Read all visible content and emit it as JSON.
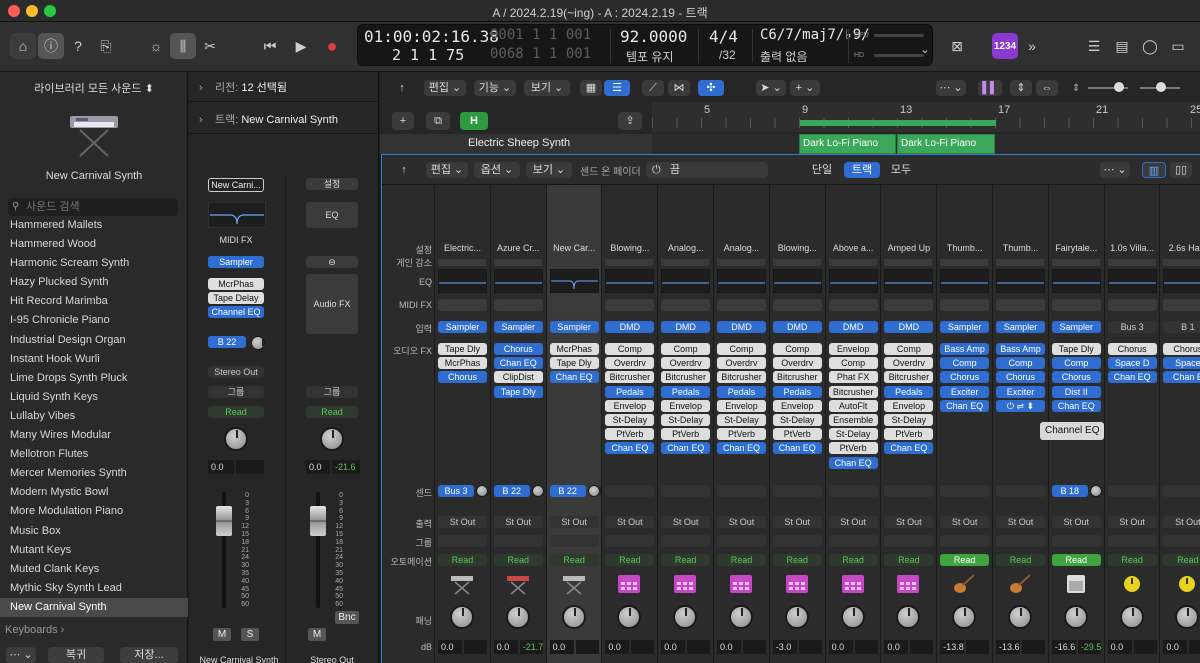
{
  "window": {
    "title": "A / 2024.2.19(~ing) - A : 2024.2.19 - 트랙"
  },
  "lcd": {
    "time": "01:00:02:16.38",
    "time_ghost": "0001 1 1 001",
    "bars": "2  1  1   75",
    "bars_ghost": "0068 1 1 001",
    "tempo": "92.0000",
    "tempo_label": "템포 유지",
    "sig_top": "4/4",
    "sig_bottom": "/32",
    "chord": "C6/7/maj7/♭9/",
    "output": "출력 없음",
    "cpu": "CPU",
    "hd": "HD"
  },
  "count_in": "1234",
  "library": {
    "header": "라이브러리   모든 사운드 ⬍",
    "patch": "New Carnival Synth",
    "search_placeholder": "사운드 검색",
    "items": [
      "Hammered Mallets",
      "Hammered Wood",
      "Harmonic Scream Synth",
      "Hazy Plucked Synth",
      "Hit Record Marimba",
      "I-95 Chronicle Piano",
      "Industrial Design Organ",
      "Instant Hook Wurli",
      "Lime Drops Synth Pluck",
      "Liquid Synth Keys",
      "Lullaby Vibes",
      "Many Wires Modular",
      "Mellotron Flutes",
      "Mercer Memories Synth",
      "Modern Mystic Bowl",
      "More Modulation Piano",
      "Music Box",
      "Mutant Keys",
      "Muted Clank Keys",
      "Mythic Sky Synth Lead",
      "New Carnival Synth"
    ],
    "selected_index": 20,
    "keyboards": "Keyboards ›",
    "revert": "복귀",
    "save": "저장..."
  },
  "inspector": {
    "region_key": "리전:",
    "region_val": "12 선택됨",
    "track_key": "트랙:",
    "track_val": "New Carnival Synth",
    "strip1": {
      "setting": "New Carni...",
      "midifx": "MIDI FX",
      "instrument": "Sampler",
      "fx": [
        "McrPhas",
        "Tape Delay",
        "Channel EQ"
      ],
      "send": "B 22",
      "output": "Stereo Out",
      "group": "그룹",
      "auto": "Read",
      "vol": "0.0",
      "peak": "",
      "m": "M",
      "s": "S",
      "name": "New Carnival Synth"
    },
    "strip2": {
      "setting": "설정",
      "eq": "EQ",
      "audiofx": "Audio FX",
      "group": "그룹",
      "auto": "Read",
      "vol": "0.0",
      "peak": "-21.6",
      "m": "M",
      "bnc": "Bnc",
      "name": "Stereo Out"
    },
    "scale": [
      "0",
      "3",
      "6",
      "9",
      "12",
      "15",
      "18",
      "21",
      "24",
      "30",
      "35",
      "40",
      "45",
      "50",
      "60"
    ]
  },
  "tracks": {
    "edit": "편집",
    "func": "기능",
    "view": "보기",
    "h_btn": "H",
    "ruler": [
      "5",
      "9",
      "13",
      "17",
      "21",
      "25"
    ],
    "track_name": "Electric Sheep Synth",
    "regions": [
      "Dark Lo-Fi Piano",
      "Dark Lo-Fi Piano"
    ]
  },
  "mixer": {
    "edit": "편집",
    "options": "옵션",
    "view": "보기",
    "sends_on_faders": "센드 온 페이더",
    "off": "끔",
    "single": "단일",
    "tracks": "트랙",
    "all": "모두",
    "row_labels": {
      "setting": "설정",
      "gain": "게인 감소",
      "eq": "EQ",
      "midifx": "MIDI FX",
      "input": "입력",
      "audiofx": "오디오 FX",
      "send": "센드",
      "output": "출력",
      "group": "그룹",
      "automation": "오토메이션",
      "pan": "패닝",
      "db": "dB"
    },
    "tooltip": "Channel EQ",
    "strips": [
      {
        "name": "Electric...",
        "input": "Sampler",
        "fx": [
          "Tape Dly",
          "McrPhas",
          "Chorus"
        ],
        "send": "Bus 3",
        "out": "St Out",
        "auto": "Read",
        "db": "0.0",
        "peak": "",
        "icon": "keyboard-stand-icon"
      },
      {
        "name": "Azure Cr...",
        "input": "Sampler",
        "fx": [
          "Chorus",
          "Chan EQ",
          "ClipDist",
          "Tape Dly"
        ],
        "send": "B 22",
        "out": "St Out",
        "auto": "Read",
        "db": "0.0",
        "peak": "-21.7",
        "icon": "keyboard-stand-red-icon"
      },
      {
        "name": "New Car...",
        "input": "Sampler",
        "fx": [
          "McrPhas",
          "Tape Dly",
          "Chan EQ"
        ],
        "send": "B 22",
        "out": "St Out",
        "auto": "Read",
        "db": "0.0",
        "peak": "",
        "icon": "keyboard-stand-icon"
      },
      {
        "name": "Blowing...",
        "input": "DMD",
        "fx": [
          "Comp",
          "Overdrv",
          "Bitcrusher",
          "Pedals",
          "Envelop",
          "St-Delay",
          "PtVerb",
          "Chan EQ"
        ],
        "send": "",
        "out": "St Out",
        "auto": "Read",
        "db": "0.0",
        "peak": "",
        "icon": "drum-machine-icon"
      },
      {
        "name": "Analog...",
        "input": "DMD",
        "fx": [
          "Comp",
          "Overdrv",
          "Bitcrusher",
          "Pedals",
          "Envelop",
          "St-Delay",
          "PtVerb",
          "Chan EQ"
        ],
        "send": "",
        "out": "St Out",
        "auto": "Read",
        "db": "0.0",
        "peak": "",
        "icon": "drum-machine-icon"
      },
      {
        "name": "Analog...",
        "input": "DMD",
        "fx": [
          "Comp",
          "Overdrv",
          "Bitcrusher",
          "Pedals",
          "Envelop",
          "St-Delay",
          "PtVerb",
          "Chan EQ"
        ],
        "send": "",
        "out": "St Out",
        "auto": "Read",
        "db": "0.0",
        "peak": "",
        "icon": "drum-machine-icon"
      },
      {
        "name": "Blowing...",
        "input": "DMD",
        "fx": [
          "Comp",
          "Overdrv",
          "Bitcrusher",
          "Pedals",
          "Envelop",
          "St-Delay",
          "PtVerb",
          "Chan EQ"
        ],
        "send": "",
        "out": "St Out",
        "auto": "Read",
        "db": "-3.0",
        "peak": "",
        "icon": "drum-machine-icon"
      },
      {
        "name": "Above a...",
        "input": "DMD",
        "fx": [
          "Envelop",
          "Comp",
          "Phat FX",
          "Bitcrusher",
          "AutoFlt",
          "Ensemble",
          "St-Delay",
          "PtVerb",
          "Chan EQ"
        ],
        "send": "",
        "out": "St Out",
        "auto": "Read",
        "db": "0.0",
        "peak": "",
        "icon": "drum-machine-icon"
      },
      {
        "name": "Amped Up",
        "input": "DMD",
        "fx": [
          "Comp",
          "Overdrv",
          "Bitcrusher",
          "Pedals",
          "Envelop",
          "St-Delay",
          "PtVerb",
          "Chan EQ"
        ],
        "send": "",
        "out": "St Out",
        "auto": "Read",
        "db": "0.0",
        "peak": "",
        "icon": "drum-machine-icon"
      },
      {
        "name": "Thumb...",
        "input": "Sampler",
        "fx": [
          "Bass Amp",
          "Comp",
          "Chorus",
          "Exciter",
          "Chan EQ"
        ],
        "send": "",
        "out": "St Out",
        "auto": "Read",
        "db": "-13.8",
        "peak": "",
        "icon": "guitar-icon",
        "auto_active": true
      },
      {
        "name": "Thumb...",
        "input": "Sampler",
        "fx": [
          "Bass Amp",
          "Comp",
          "Chorus",
          "Exciter"
        ],
        "send": "",
        "out": "St Out",
        "auto": "Read",
        "db": "-13.6",
        "peak": "",
        "icon": "guitar-icon"
      },
      {
        "name": "Fairytale...",
        "input": "Sampler",
        "fx": [
          "Tape Dly",
          "Comp",
          "Chorus",
          "Dist II",
          "Chan EQ"
        ],
        "send": "B 18",
        "out": "St Out",
        "auto": "Read",
        "db": "-16.6",
        "peak": "-29.5",
        "icon": "amp-icon",
        "auto_active": true
      },
      {
        "name": "1.0s Villa...",
        "input": "Bus 3",
        "fx": [
          "Chorus",
          "Space D",
          "Chan EQ"
        ],
        "send": "",
        "out": "St Out",
        "auto": "Read",
        "db": "0.0",
        "peak": "",
        "icon": "aux-icon"
      },
      {
        "name": "2.6s Ha...",
        "input": "B 1",
        "fx": [
          "Chorus",
          "Space",
          "Chan E"
        ],
        "send": "",
        "out": "St Out",
        "auto": "Read",
        "db": "0.0",
        "peak": "",
        "icon": "aux-icon"
      }
    ]
  },
  "colors": {
    "accent": "#2f6dd0",
    "green": "#3aa75a",
    "record": "#e23b3b"
  }
}
